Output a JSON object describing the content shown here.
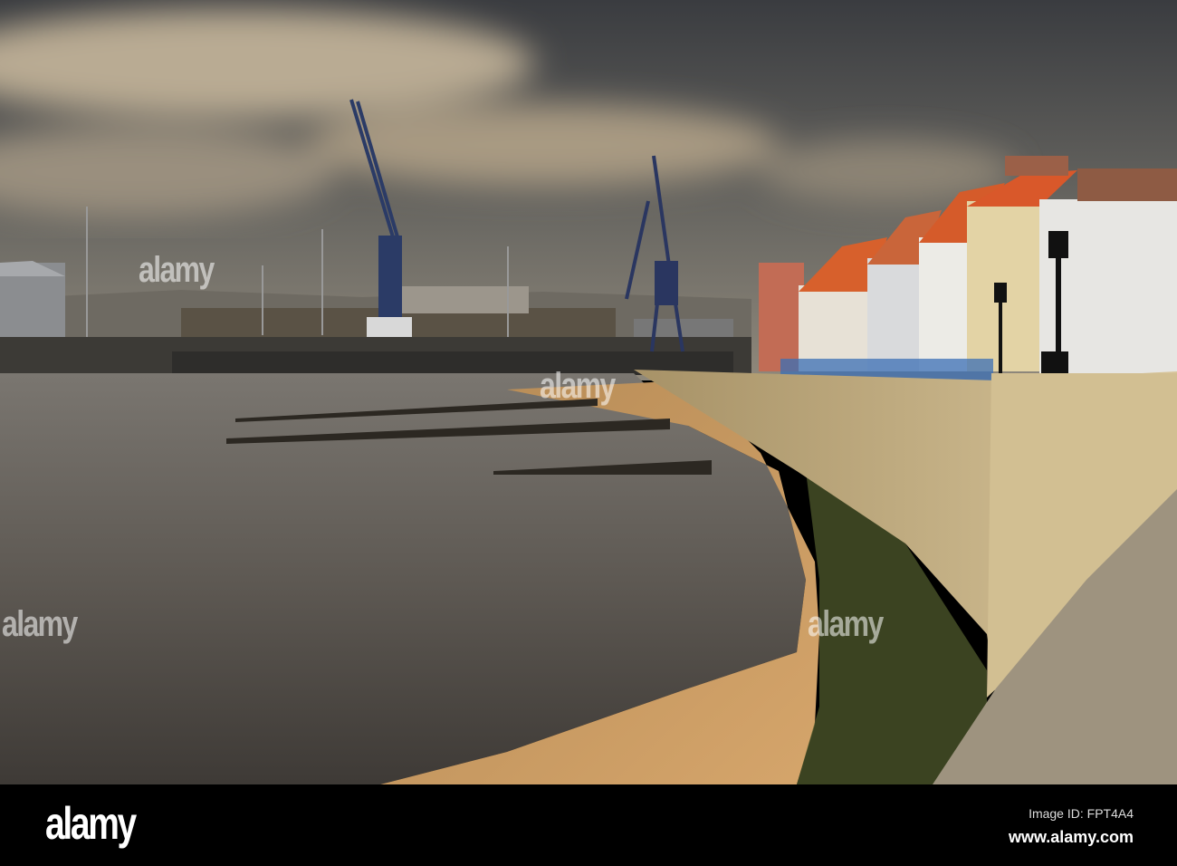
{
  "watermark": {
    "text": "alamy"
  },
  "footer": {
    "logo": "alamy",
    "image_id": "Image ID: FPT4A4",
    "url": "www.alamy.com"
  },
  "colors": {
    "sky": "#3b3d42",
    "cloud": "#b7a88f",
    "water": "#5f5a55",
    "sand": "#c79a62",
    "wall": "#c8b58a",
    "roof": "#d8612e"
  }
}
